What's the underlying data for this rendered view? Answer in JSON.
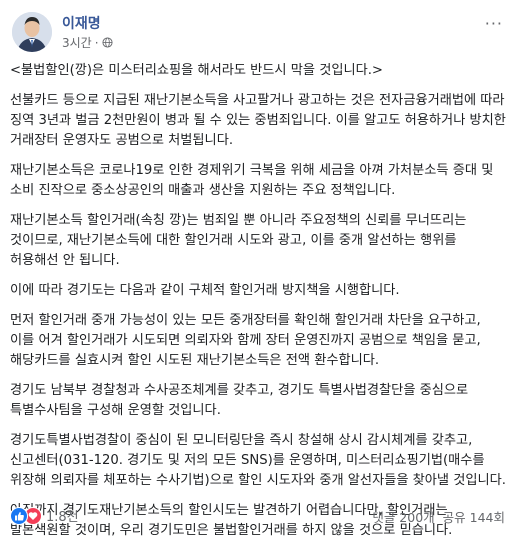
{
  "post": {
    "author": "이재명",
    "time": "3시간",
    "more_label": "···",
    "paragraphs": [
      "<불법할인(깡)은 미스터리쇼핑을 해서라도 반드시 막을 것입니다.>",
      "선불카드 등으로 지급된 재난기본소득을 사고팔거나 광고하는 것은 전자금융거래법에 따라 징역 3년과 벌금 2천만원이 병과 될 수 있는 중범죄입니다. 이를 알고도 허용하거나 방치한 거래장터 운영자도 공범으로 처벌됩니다.",
      "재난기본소득은 코로나19로 인한 경제위기 극복을 위해 세금을 아껴 가처분소득 증대 및 소비 진작으로 중소상공인의 매출과 생산을 지원하는 주요 정책입니다.",
      "재난기본소득 할인거래(속칭 깡)는 범죄일 뿐 아니라 주요정책의 신뢰를 무너뜨리는 것이므로, 재난기본소득에 대한 할인거래 시도와 광고, 이를 중개 알선하는 행위를 허용해선 안 됩니다.",
      "이에 따라 경기도는 다음과 같이 구체적 할인거래 방지책을 시행합니다.",
      "먼저 할인거래 중개 가능성이 있는 모든 중개장터를 확인해 할인거래 차단을 요구하고, 이를 어겨 할인거래가 시도되면 의뢰자와 함께 장터 운영진까지 공범으로 책임을 묻고, 해당카드를 실효시켜 할인 시도된 재난기본소득은 전액 환수합니다.",
      "경기도 남북부 경찰청과 수사공조체계를 갖추고, 경기도 특별사법경찰단을 중심으로 특별수사팀을 구성해 운영할 것입니다.",
      "경기도특별사법경찰이 중심이 된 모니터링단을 즉시 창설해 상시 감시체계를 갖추고, 신고센터(031-120. 경기도 및 저의 모든 SNS)를 운영하며, 미스터리쇼핑기법(매수를 위장해 의뢰자를 체포하는 수사기법)으로 할인 시도자와 중개 알선자들을 찾아낼 것입니다.",
      "아직까지 경기도재난기본소득의 할인시도는 발견하기 어렵습니다만, 할인거래는 발본색원할 것이며, 우리 경기도민은 불법할인거래를 하지 않을 것으로 믿습니다."
    ]
  },
  "footer": {
    "reaction_count": "1.8천",
    "comments": "댓글 200개",
    "shares": "공유 144회"
  },
  "colors": {
    "author": "#385898",
    "meta": "#65676b",
    "like": "#1877f2",
    "love": "#f33e58"
  },
  "icons": [
    "avatar-photo",
    "globe-icon",
    "more-options-icon",
    "like-reaction-icon",
    "love-reaction-icon"
  ]
}
